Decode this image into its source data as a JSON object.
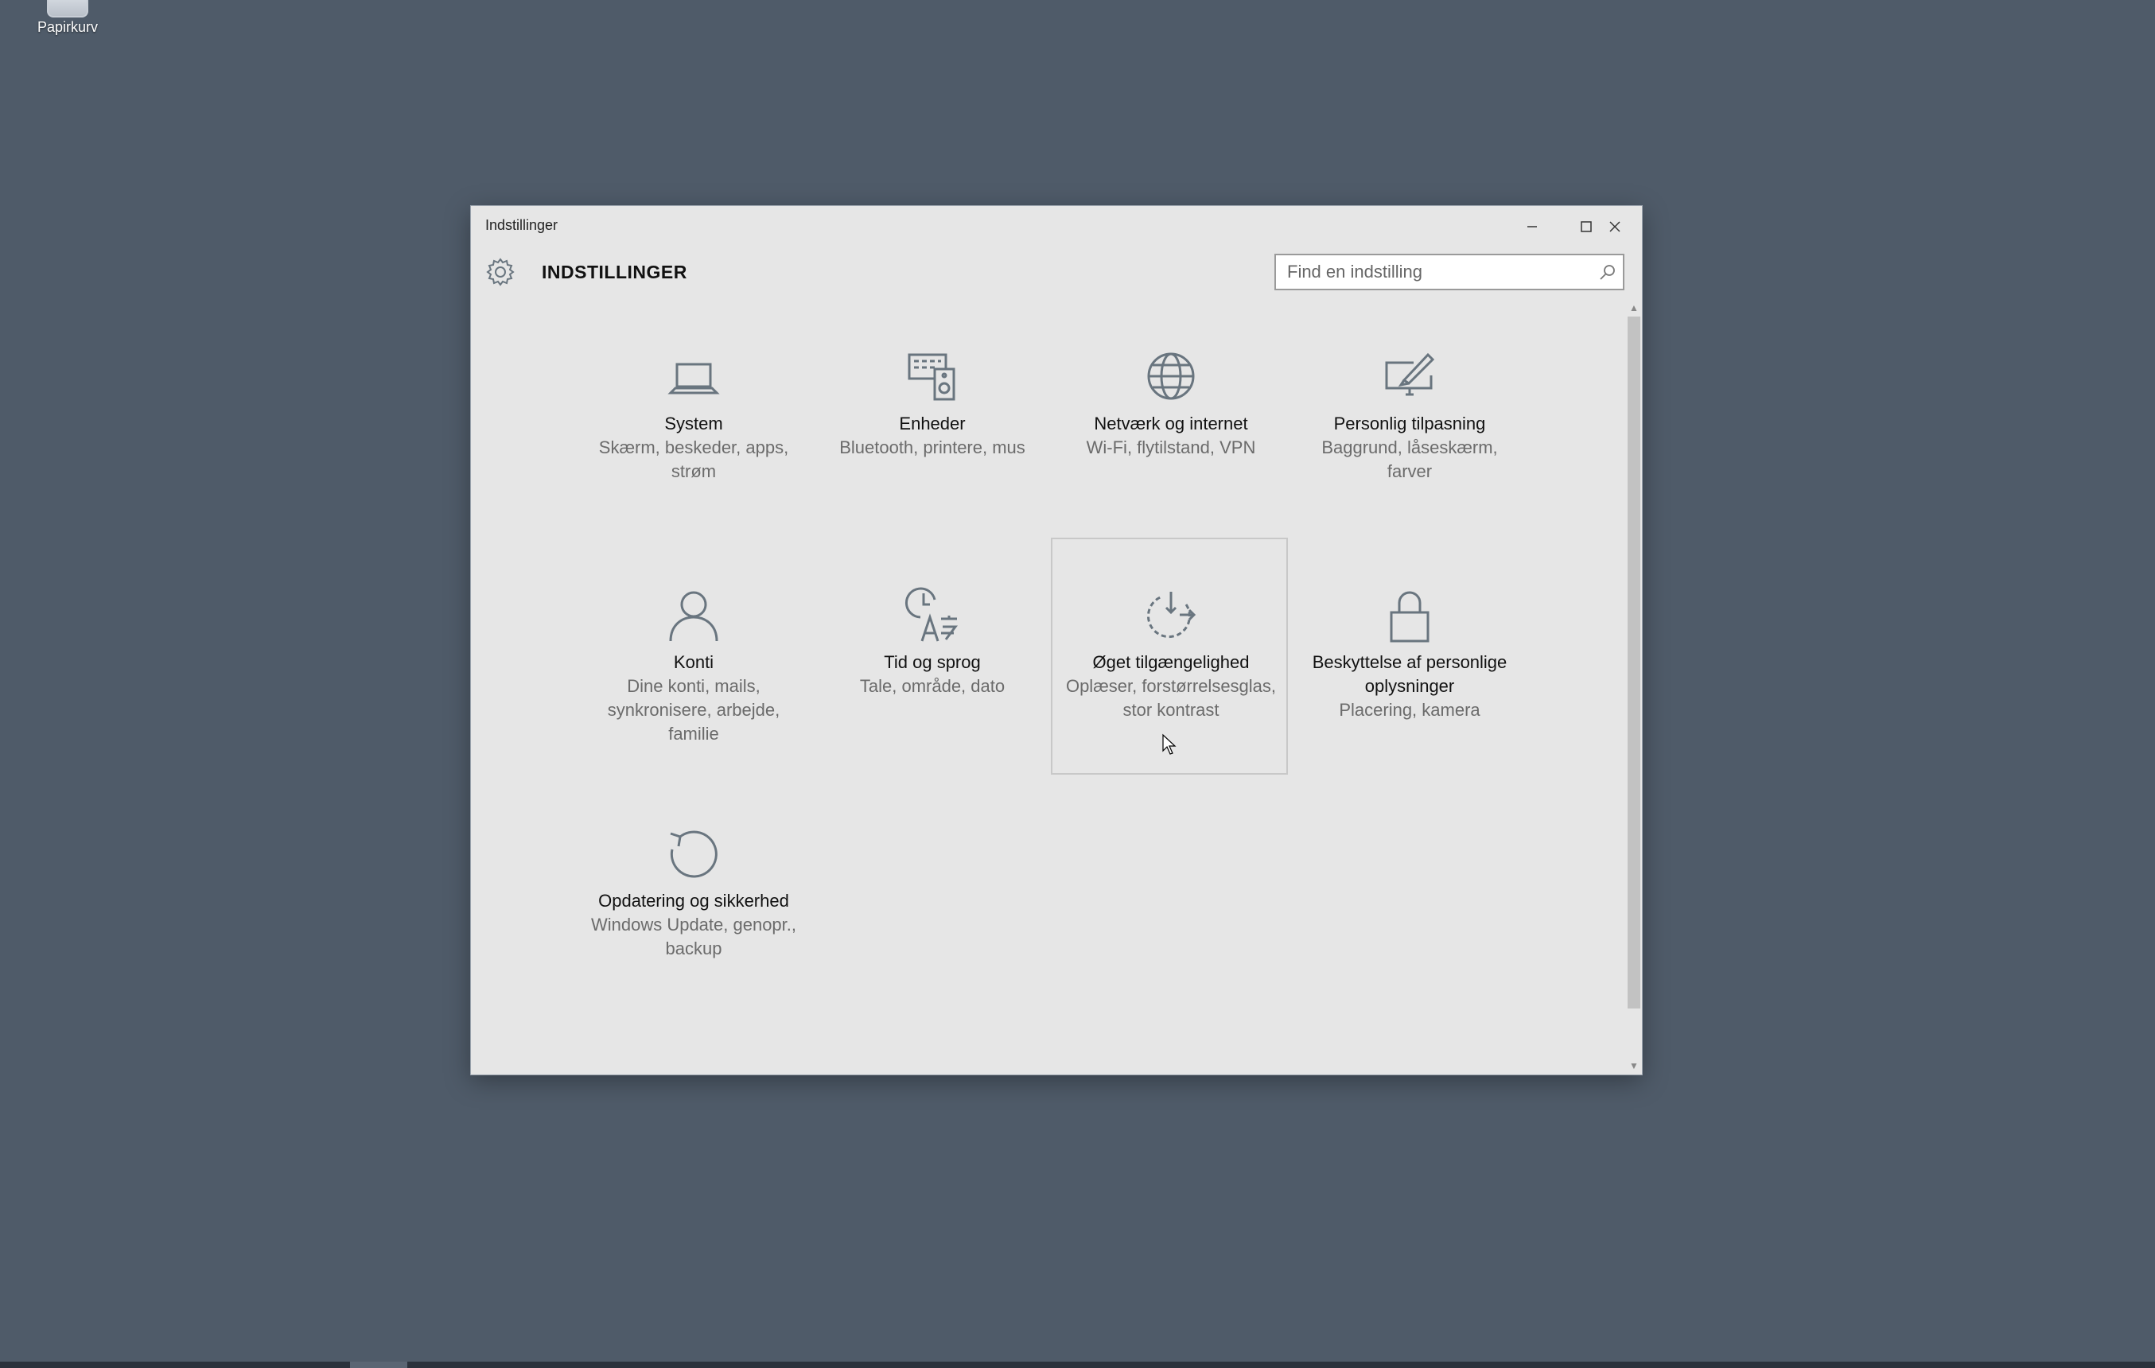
{
  "desktop": {
    "recycle_bin_label": "Papirkurv"
  },
  "window": {
    "title": "Indstillinger",
    "controls": {
      "minimize_icon": "minimize-icon",
      "maximize_icon": "maximize-icon",
      "close_icon": "close-icon"
    }
  },
  "header": {
    "heading": "INDSTILLINGER",
    "icon": "gear-icon",
    "search": {
      "placeholder": "Find en indstilling",
      "value": "",
      "icon": "search-icon"
    }
  },
  "categories": [
    {
      "name": "System",
      "desc": "Skærm, beskeder, apps, strøm",
      "icon": "laptop-icon"
    },
    {
      "name": "Enheder",
      "desc": "Bluetooth, printere, mus",
      "icon": "devices-icon"
    },
    {
      "name": "Netværk og internet",
      "desc": "Wi-Fi, flytilstand, VPN",
      "icon": "globe-icon"
    },
    {
      "name": "Personlig tilpasning",
      "desc": "Baggrund, låseskærm, farver",
      "icon": "personalization-icon"
    },
    {
      "name": "Konti",
      "desc": "Dine konti, mails, synkronisere, arbejde, familie",
      "icon": "person-icon"
    },
    {
      "name": "Tid og sprog",
      "desc": "Tale, område, dato",
      "icon": "time-language-icon"
    },
    {
      "name": "Øget tilgængelighed",
      "desc": "Oplæser, forstørrelsesglas, stor kontrast",
      "icon": "ease-of-access-icon"
    },
    {
      "name": "Beskyttelse af personlige oplysninger",
      "desc": "Placering, kamera",
      "icon": "lock-icon"
    },
    {
      "name": "Opdatering og sikkerhed",
      "desc": "Windows Update, genopr., backup",
      "icon": "update-icon"
    }
  ],
  "colors": {
    "desktop_bg": "#4f5b69",
    "window_bg": "#e6e6e6",
    "icon_stroke": "#69757f"
  }
}
